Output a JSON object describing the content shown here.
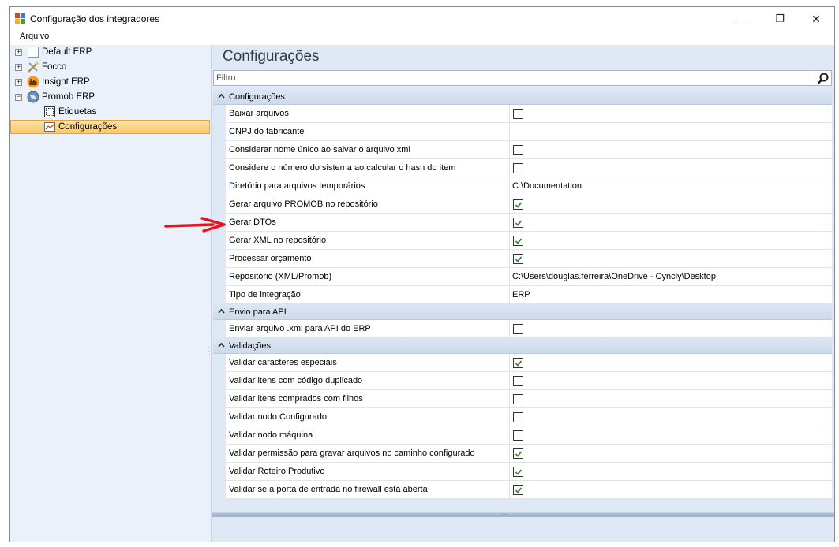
{
  "window": {
    "title": "Configuração dos integradores",
    "controls": {
      "minimize": "—",
      "maximize": "❐",
      "close": "✕"
    }
  },
  "menu": {
    "items": [
      "Arquivo"
    ]
  },
  "tree": {
    "items": [
      {
        "label": "Default ERP",
        "expander": "+"
      },
      {
        "label": "Focco",
        "expander": "+"
      },
      {
        "label": "Insight ERP",
        "expander": "+"
      },
      {
        "label": "Promob ERP",
        "expander": "−"
      },
      {
        "label": "Etiquetas"
      },
      {
        "label": "Configurações",
        "selected": true
      }
    ]
  },
  "main": {
    "title": "Configurações",
    "filter_placeholder": "Filtro",
    "categories": [
      {
        "label": "Configurações",
        "rows": [
          {
            "name": "Baixar arquivos",
            "type": "checkbox",
            "checked": false
          },
          {
            "name": "CNPJ do fabricante",
            "type": "text",
            "value": ""
          },
          {
            "name": "Considerar nome único ao salvar o arquivo xml",
            "type": "checkbox",
            "checked": false
          },
          {
            "name": "Considere o número do sistema ao calcular o hash do item",
            "type": "checkbox",
            "checked": false
          },
          {
            "name": "Diretório para arquivos temporários",
            "type": "text",
            "value": "C:\\Documentation"
          },
          {
            "name": "Gerar arquivo PROMOB no repositório",
            "type": "checkbox",
            "checked": true
          },
          {
            "name": "Gerar DTOs",
            "type": "checkbox",
            "checked": true
          },
          {
            "name": "Gerar XML no repositório",
            "type": "checkbox",
            "checked": true
          },
          {
            "name": "Processar orçamento",
            "type": "checkbox",
            "checked": true
          },
          {
            "name": "Repositório (XML/Promob)",
            "type": "text",
            "value": "C:\\Users\\douglas.ferreira\\OneDrive - Cyncly\\Desktop"
          },
          {
            "name": "Tipo de integração",
            "type": "text",
            "value": "ERP"
          }
        ]
      },
      {
        "label": "Envio para API",
        "rows": [
          {
            "name": "Enviar arquivo .xml para API do ERP",
            "type": "checkbox",
            "checked": false
          }
        ]
      },
      {
        "label": "Validações",
        "rows": [
          {
            "name": "Validar caracteres especiais",
            "type": "checkbox",
            "checked": true
          },
          {
            "name": "Validar itens com código duplicado",
            "type": "checkbox",
            "checked": false
          },
          {
            "name": "Validar itens comprados com filhos",
            "type": "checkbox",
            "checked": false
          },
          {
            "name": "Validar nodo Configurado",
            "type": "checkbox",
            "checked": false
          },
          {
            "name": "Validar nodo máquina",
            "type": "checkbox",
            "checked": false
          },
          {
            "name": "Validar permissão para gravar arquivos no caminho configurado",
            "type": "checkbox",
            "checked": true
          },
          {
            "name": "Validar Roteiro Produtivo",
            "type": "checkbox",
            "checked": true
          },
          {
            "name": "Validar se a porta de entrada no firewall está aberta",
            "type": "checkbox",
            "checked": true
          }
        ]
      }
    ]
  },
  "colors": {
    "check": "#3a8a3a",
    "selection": "#f9c86a",
    "annotation_arrow": "#e8141a"
  }
}
